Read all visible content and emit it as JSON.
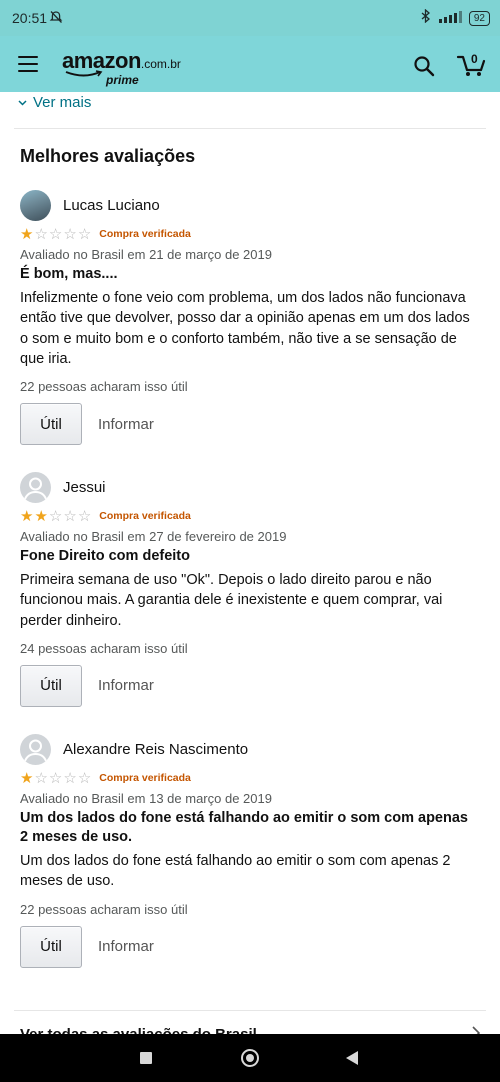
{
  "status_bar": {
    "time": "20:51",
    "battery": "92"
  },
  "header": {
    "logo_text": "amazon",
    "logo_suffix": ".com.br",
    "logo_sub": "prime",
    "cart_count": "0"
  },
  "ver_mais": "Ver mais",
  "section_title": "Melhores avaliações",
  "reviews": [
    {
      "reviewer": "Lucas Luciano",
      "rating": 1,
      "badge": "Compra verificada",
      "meta": "Avaliado no Brasil em 21 de março de 2019",
      "title": "É bom, mas....",
      "body": "Infelizmente o fone veio com problema, um dos lados não funcionava então tive que devolver, posso dar a opinião apenas em um dos lados o som e muito bom e o conforto também, não tive a se sensação de que iria.",
      "helpful": "22 pessoas acharam isso útil",
      "util_label": "Útil",
      "report_label": "Informar"
    },
    {
      "reviewer": "Jessui",
      "rating": 2,
      "badge": "Compra verificada",
      "meta": "Avaliado no Brasil em 27 de fevereiro de 2019",
      "title": "Fone Direito com defeito",
      "body": "Primeira semana de uso \"Ok\". Depois o lado direito parou e não funcionou mais. A garantia dele é inexistente e quem comprar, vai perder dinheiro.",
      "helpful": "24 pessoas acharam isso útil",
      "util_label": "Útil",
      "report_label": "Informar"
    },
    {
      "reviewer": "Alexandre Reis Nascimento",
      "rating": 1,
      "badge": "Compra verificada",
      "meta": "Avaliado no Brasil em 13 de março de 2019",
      "title": "Um dos lados do fone está falhando ao emitir o som com apenas 2 meses de uso.",
      "body": "Um dos lados do fone está falhando ao emitir o som com apenas 2 meses de uso.",
      "helpful": "22 pessoas acharam isso útil",
      "util_label": "Útil",
      "report_label": "Informar"
    }
  ],
  "see_all": "Ver todas as avaliações do Brasil",
  "colors": {
    "accent_teal": "#7fd6d9",
    "link": "#007185",
    "star": "#f0a41c",
    "verified": "#c45500"
  }
}
